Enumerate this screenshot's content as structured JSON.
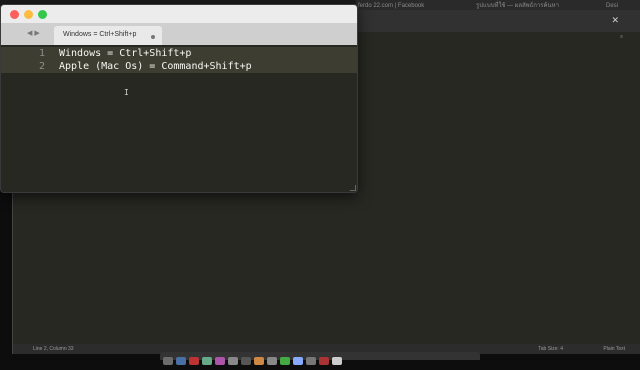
{
  "background_browser": {
    "tabs": [
      {
        "label": "ferdo 22.com | Facebook"
      },
      {
        "label": "รูปแบบที่ใช้ — ผลลัพธ์การค้นหา"
      },
      {
        "label": "Desi"
      }
    ]
  },
  "background_window": {
    "status_left": "Line 2, Column 33",
    "status_tab_size": "Tab Size: 4",
    "status_syntax": "Plain Text"
  },
  "editor_window": {
    "tab_title": "Windows = Ctrl+Shift+p",
    "lines": [
      {
        "number": "1",
        "text": "Windows = Ctrl+Shift+p"
      },
      {
        "number": "2",
        "text": "Apple (Mac Os) = Command+Shift+p"
      }
    ]
  },
  "colors": {
    "editor_bg": "#272822",
    "active_line": "#3e3d32",
    "text": "#f8f8f2",
    "traffic_close": "#fc605c",
    "traffic_minimize": "#fdbc40",
    "traffic_zoom": "#34c84a"
  },
  "icons": {
    "nav": "left-right-arrows",
    "cursor": "i-beam-cursor"
  }
}
